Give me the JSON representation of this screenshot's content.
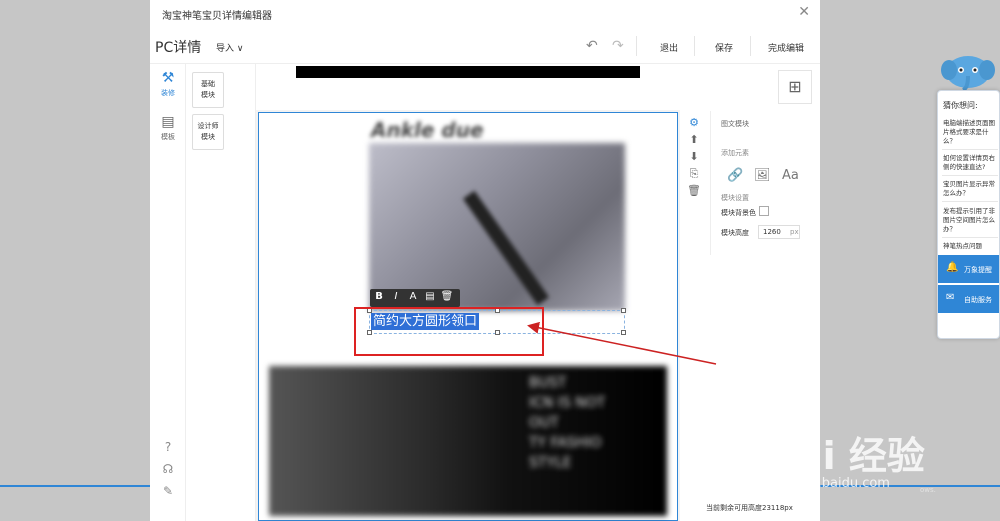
{
  "window": {
    "title": "淘宝神笔宝贝详情编辑器",
    "close": "✕"
  },
  "toolbar": {
    "pc_title": "PC详情",
    "import": "导入 ∨",
    "undo": "↶",
    "redo": "↷",
    "exit": "退出",
    "save": "保存",
    "finish": "完成编辑"
  },
  "left_rail": {
    "items": [
      {
        "icon": "hammer-icon",
        "label": "装修"
      },
      {
        "icon": "template-icon",
        "label": "模板"
      }
    ]
  },
  "modules": {
    "basic": "基础\n模块",
    "designer": "设计师\n模块"
  },
  "canvas": {
    "handwriting": "Ankle due",
    "selected_text": "简约大方圆形领口",
    "bottom_text": "BUST\nICN IS NOT\nOUT\nTY FASHIO\nSTYLE"
  },
  "float_tools": [
    "B",
    "I",
    "A",
    "▤",
    "🗑"
  ],
  "side_tools": [
    "⚙",
    "⬆",
    "⬇",
    "⎘",
    "🗑"
  ],
  "props": {
    "header": "图文模块",
    "add_element": "添加元素",
    "text_icon": "Aa",
    "module_settings": "模块设置",
    "bg_color": "模块背景色",
    "height_label": "模块高度",
    "height_value": "1260",
    "height_unit": "px"
  },
  "remaining_height": "当前剩余可用高度23118px",
  "helper": {
    "title": "猜你想问:",
    "questions": [
      "电脑端描述页面图片格式要求是什么？",
      "如何设置详情页右侧的快速直达?",
      "宝贝图片显示异常怎么办？",
      "发布提示引用了非图片空间图片怎么办？",
      "神笔热点问题"
    ],
    "buttons": [
      {
        "icon": "bell-icon",
        "label": "万象提醒"
      },
      {
        "icon": "chat-icon",
        "label": "自助服务"
      }
    ]
  },
  "watermark": {
    "main": "Bai 经验",
    "sub": "jingyan.baidu.com",
    "grey": "ows."
  },
  "colors": {
    "accent": "#2f86d6",
    "annotation_red": "#dd2222",
    "selection": "#2f6fd6"
  }
}
